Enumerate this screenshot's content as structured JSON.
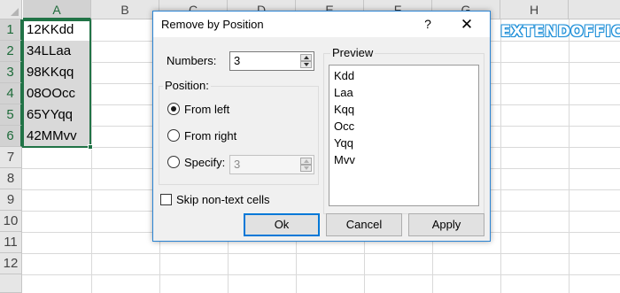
{
  "spreadsheet": {
    "columns": [
      "A",
      "B",
      "C",
      "D",
      "E",
      "F",
      "G",
      "H"
    ],
    "rows": [
      "1",
      "2",
      "3",
      "4",
      "5",
      "6",
      "7",
      "8",
      "9",
      "10",
      "11",
      "12"
    ],
    "cells_a": [
      "12KKdd",
      "34LLaa",
      "98KKqq",
      "08OOcc",
      "65YYqq",
      "42MMvv"
    ],
    "selection_color": "#217346",
    "brand_watermark": "EXTENDOFFICE"
  },
  "dialog": {
    "title": "Remove by Position",
    "help_label": "?",
    "close_label": "✕",
    "numbers_label": "Numbers:",
    "numbers_value": "3",
    "position_group_label": "Position:",
    "from_left_label": "From left",
    "from_right_label": "From right",
    "specify_label": "Specify:",
    "specify_value": "3",
    "selected_position": "From left",
    "skip_label": "Skip non-text cells",
    "skip_checked": false,
    "preview_label": "Preview",
    "preview_items": [
      "Kdd",
      "Laa",
      "Kqq",
      "Occ",
      "Yqq",
      "Mvv"
    ],
    "ok_label": "Ok",
    "cancel_label": "Cancel",
    "apply_label": "Apply",
    "accent_color": "#0078d7"
  }
}
